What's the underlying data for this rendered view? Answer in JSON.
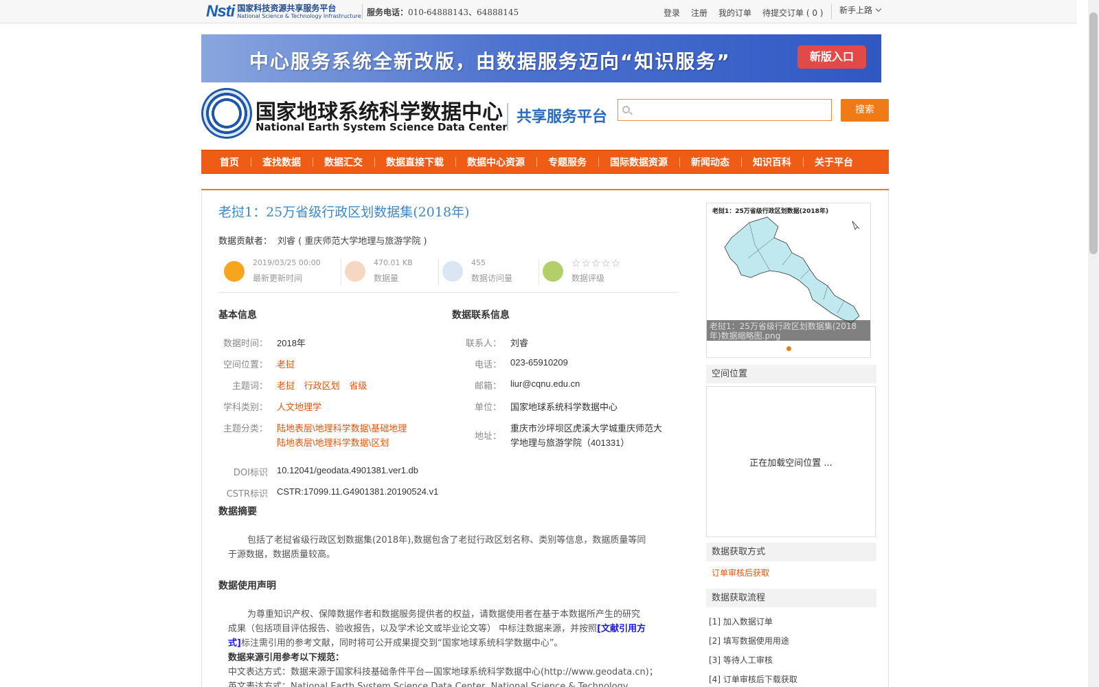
{
  "topbar": {
    "logo_mark": "Nsti",
    "logo_cn": "国家科技资源共享服务平台",
    "logo_en": "National Science & Technology Infrastructure",
    "service_label": "服务电话：",
    "service_phone": "010-64888143、64888145",
    "links": [
      "登录",
      "注册",
      "我的订单",
      "待提交订单 ( 0 )"
    ],
    "guide": "新手上路"
  },
  "banner": {
    "text": "中心服务系统全新改版，由数据服务迈向“知识服务”",
    "button": "新版入口"
  },
  "header": {
    "logo_cn": "国家地球系统科学数据中心",
    "logo_en": "National Earth System Science Data Center",
    "subtitle": "共享服务平台",
    "search_placeholder": "",
    "search_button": "搜索"
  },
  "nav": [
    "首页",
    "查找数据",
    "数据汇交",
    "数据直接下载",
    "数据中心资源",
    "专题服务",
    "国际数据资源",
    "新闻动态",
    "知识百科",
    "关于平台"
  ],
  "dataset": {
    "title": "老挝1：25万省级行政区划数据集(2018年)",
    "contributor_label": "数据贡献者：",
    "contributor": "刘睿 ( 重庆师范大学地理与旅游学院 )",
    "stats": [
      {
        "value": "2019/03/25 00:00",
        "label": "最新更新时间",
        "color": "#f7a51d"
      },
      {
        "value": "470.01 KB",
        "label": "数据量",
        "color": "#f6d7c3"
      },
      {
        "value": "455",
        "label": "数据访问量",
        "color": "#dbe6f4"
      },
      {
        "value": "☆☆☆☆☆",
        "label": "数据评级",
        "color": "#b3cf6a"
      }
    ],
    "basic_info_title": "基本信息",
    "contact_title": "数据联系信息",
    "basic": {
      "time_label": "数据时间：",
      "time": "2018年",
      "space_label": "空间位置：",
      "space": "老挝",
      "keywords_label": "主题词：",
      "keywords": [
        "老挝",
        "行政区划",
        "省级"
      ],
      "discipline_label": "学科类别：",
      "discipline": "人文地理学",
      "category_label": "主题分类：",
      "category": [
        "陆地表层\\地理科学数据\\基础地理",
        "陆地表层\\地理科学数据\\区划"
      ],
      "doi_label": "DOI标识",
      "doi": "10.12041/geodata.4901381.ver1.db",
      "cstr_label": "CSTR标识",
      "cstr": "CSTR:17099.11.G4901381.20190524.v1"
    },
    "contact": {
      "person_label": "联系人：",
      "person": "刘睿",
      "phone_label": "电话：",
      "phone": "023-65910209",
      "email_label": "邮箱：",
      "email": "liur@cqnu.edu.cn",
      "unit_label": "单位：",
      "unit": "国家地球系统科学数据中心",
      "address_label": "地址：",
      "address_1": "重庆市沙坪坝区虎溪大学城重庆师范大",
      "address_2": "学地理与旅游学院（401331）"
    },
    "abstract_title": "数据摘要",
    "abstract_1": "包括了老挝省级行政区划数据集(2018年),数据包含了老挝行政区划名称、类别等信息，数据质量等同",
    "abstract_2": "于源数据，数据质量较高。",
    "usage_title": "数据使用声明",
    "usage_1": "为尊重知识产权、保障数据作者和数据服务提供者的权益，请数据使用者在基于本数据所产生的研究",
    "usage_2a": "成果（包括项目评估报告、验收报告，以及学术论文或毕业论文等） 中标注数据来源，并按照",
    "usage_link": "[文献引用方",
    "usage_3_link": "式]",
    "usage_3": "标注需引用的参考文献，同时将可公开成果提交到“国家地球系统科学数据中心”。",
    "cite_title": "数据来源引用参考以下规范：",
    "cite_cn": "中文表达方式：数据来源于国家科技基础条件平台—国家地球系统科学数据中心(http://www.geodata.cn)；",
    "cite_en": "英文表达方式：National Earth System Science Data Center, National Science & Technology"
  },
  "sidebar": {
    "thumb_title": "老挝1：25万省级行政区划数据(2018年)",
    "thumb_caption": "老挝1：25万省级行政区划数据集(2018年)数据缩略图.png",
    "space_title": "空间位置",
    "loading": "正在加载空间位置 ...",
    "access_title": "数据获取方式",
    "access_value": "订单审核后获取",
    "flow_title": "数据获取流程",
    "steps": [
      "[1] 加入数据订单",
      "[2] 填写数据使用用途",
      "[3] 等待人工审核",
      "[4] 订单审核后下载获取"
    ]
  }
}
